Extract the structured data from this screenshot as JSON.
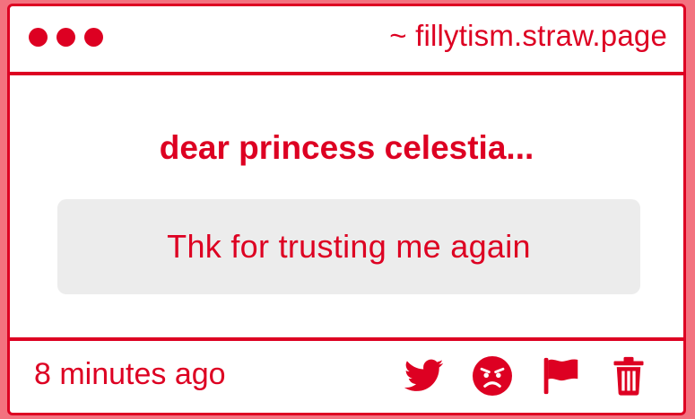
{
  "window": {
    "site_label": "~ fillytism.straw.page"
  },
  "main": {
    "heading": "dear princess celestia...",
    "message": "Thk for trusting me again"
  },
  "footer": {
    "timestamp": "8 minutes ago",
    "actions": [
      {
        "icon": "twitter-icon"
      },
      {
        "icon": "angry-face-icon"
      },
      {
        "icon": "flag-icon"
      },
      {
        "icon": "trash-icon"
      }
    ]
  },
  "colors": {
    "accent": "#dd0022",
    "page_background": "#f3727f",
    "card_background": "#ffffff",
    "message_background": "#ececec"
  }
}
